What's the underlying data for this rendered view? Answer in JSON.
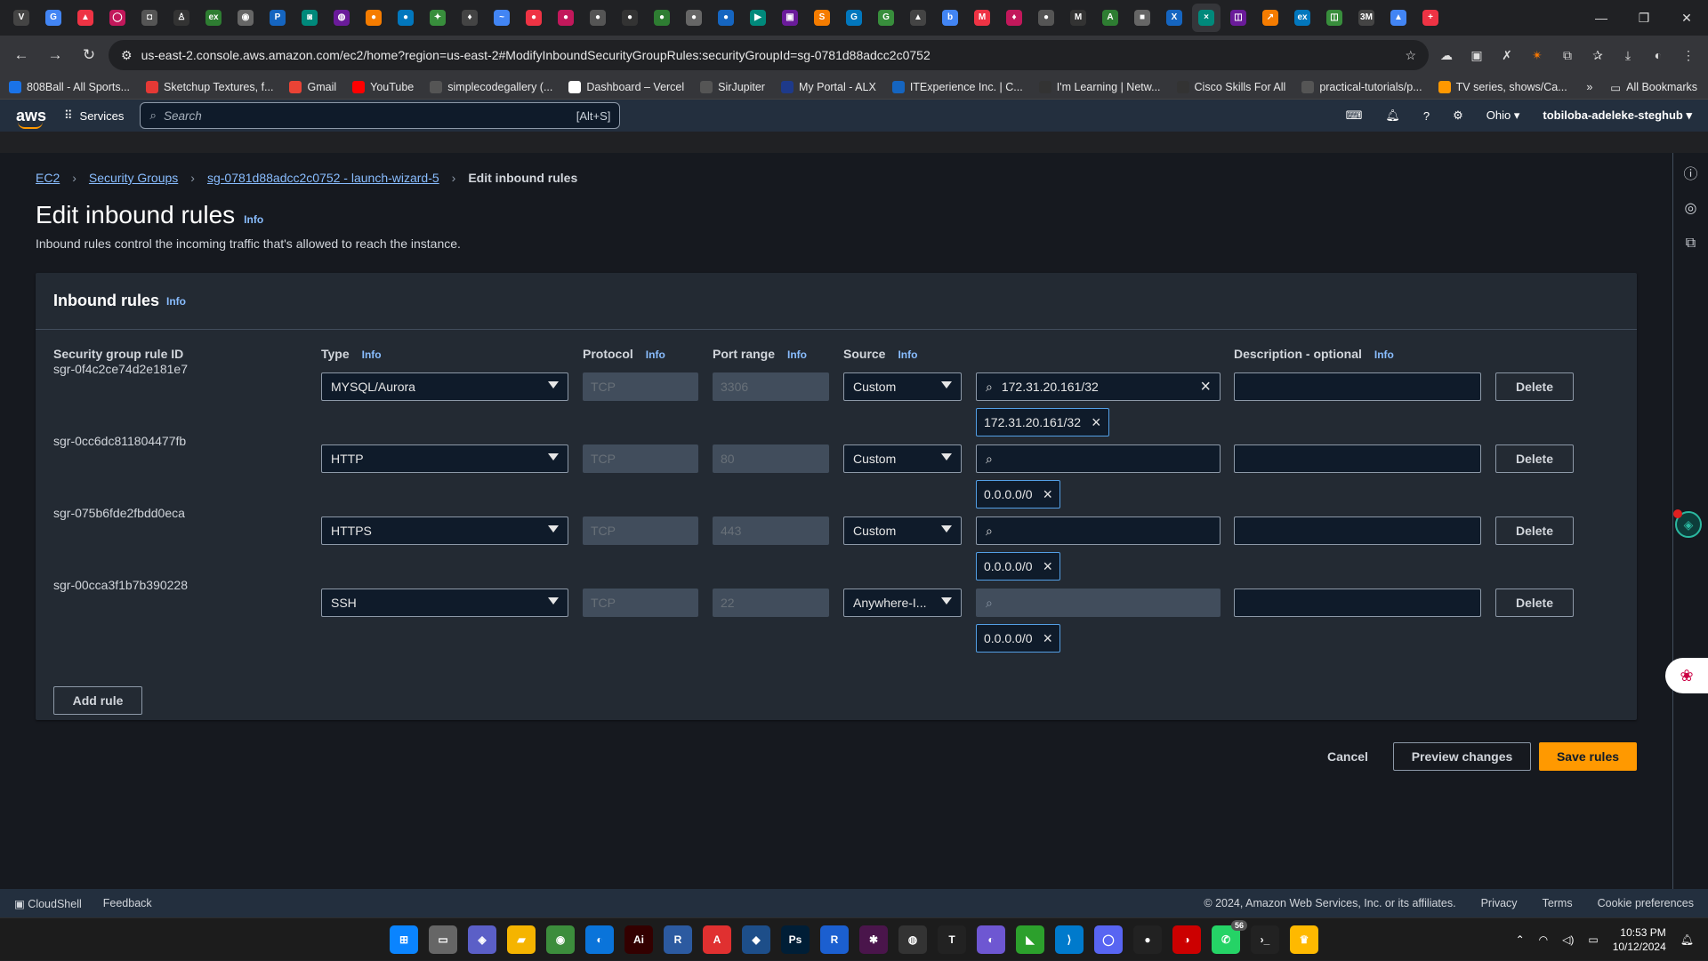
{
  "browser": {
    "tabs": [
      "V",
      "G",
      "▲",
      "◯",
      "◘",
      "♙",
      "ex",
      "◉",
      "P",
      "◙",
      "◍",
      "●",
      "●",
      "✦",
      "♦",
      "~",
      "●",
      "●",
      "●",
      "●",
      "●",
      "●",
      "●",
      "▶",
      "▣",
      "S",
      "G",
      "G",
      "▲",
      "b",
      "M",
      "♦",
      "●",
      "M",
      "A",
      "■",
      "X",
      "×",
      "◫",
      "↗",
      "ex",
      "◫",
      "3M",
      "▲",
      "+"
    ],
    "url": "us-east-2.console.aws.amazon.com/ec2/home?region=us-east-2#ModifyInboundSecurityGroupRules:securityGroupId=sg-0781d88adcc2c0752",
    "bookmarks": [
      "808Ball - All Sports...",
      "Sketchup Textures, f...",
      "Gmail",
      "YouTube",
      "simplecodegallery (...",
      "Dashboard – Vercel",
      "SirJupiter",
      "My Portal - ALX",
      "ITExperience Inc. | C...",
      "I'm Learning | Netw...",
      "Cisco Skills For All",
      "practical-tutorials/p...",
      "TV series, shows/Ca..."
    ],
    "all_bookmarks": "All Bookmarks",
    "more_bookmarks": "»"
  },
  "aws": {
    "logo": "aws",
    "services": "Services",
    "search_placeholder": "Search",
    "search_shortcut": "[Alt+S]",
    "region": "Ohio ▾",
    "account": "tobiloba-adeleke-steghub ▾"
  },
  "breadcrumb": {
    "ec2": "EC2",
    "security_groups": "Security Groups",
    "sg": "sg-0781d88adcc2c0752 - launch-wizard-5",
    "current": "Edit inbound rules"
  },
  "page": {
    "title": "Edit inbound rules",
    "info": "Info",
    "subtitle": "Inbound rules control the incoming traffic that's allowed to reach the instance."
  },
  "panel": {
    "title": "Inbound rules",
    "columns": {
      "id": "Security group rule ID",
      "type": "Type",
      "protocol": "Protocol",
      "port": "Port range",
      "source": "Source",
      "description": "Description - optional"
    },
    "rules": [
      {
        "id": "sgr-0f4c2ce74d2e181e7",
        "type": "MYSQL/Aurora",
        "protocol": "TCP",
        "port": "3306",
        "source": "Custom",
        "search": "172.31.20.161/32",
        "token": "172.31.20.161/32"
      },
      {
        "id": "sgr-0cc6dc811804477fb",
        "type": "HTTP",
        "protocol": "TCP",
        "port": "80",
        "source": "Custom",
        "search": "",
        "token": "0.0.0.0/0"
      },
      {
        "id": "sgr-075b6fde2fbdd0eca",
        "type": "HTTPS",
        "protocol": "TCP",
        "port": "443",
        "source": "Custom",
        "search": "",
        "token": "0.0.0.0/0"
      },
      {
        "id": "sgr-00cca3f1b7b390228",
        "type": "SSH",
        "protocol": "TCP",
        "port": "22",
        "source": "Anywhere-I...",
        "search": "",
        "token": "0.0.0.0/0"
      }
    ],
    "delete": "Delete",
    "add_rule": "Add rule"
  },
  "actions": {
    "cancel": "Cancel",
    "preview": "Preview changes",
    "save": "Save rules"
  },
  "footer": {
    "cloudshell": "CloudShell",
    "feedback": "Feedback",
    "copyright": "© 2024, Amazon Web Services, Inc. or its affiliates.",
    "privacy": "Privacy",
    "terms": "Terms",
    "cookies": "Cookie preferences"
  },
  "taskbar": {
    "apps": [
      "⊞",
      "▭",
      "◈",
      "▰",
      "◉",
      "◐",
      "Ai",
      "R",
      "A",
      "◆",
      "Ps",
      "R",
      "✱",
      "◍",
      "T",
      "◐",
      "◣",
      "⟩",
      "◯",
      "●",
      "◑",
      "✆",
      "›_",
      "♛"
    ],
    "badge": "56",
    "time": "10:53 PM",
    "date": "10/12/2024"
  },
  "colors": {
    "accent": "#ff9900",
    "link": "#89bdff",
    "aws_nav": "#232f3e",
    "console_bg": "#16191f",
    "panel_bg": "#232a33"
  }
}
